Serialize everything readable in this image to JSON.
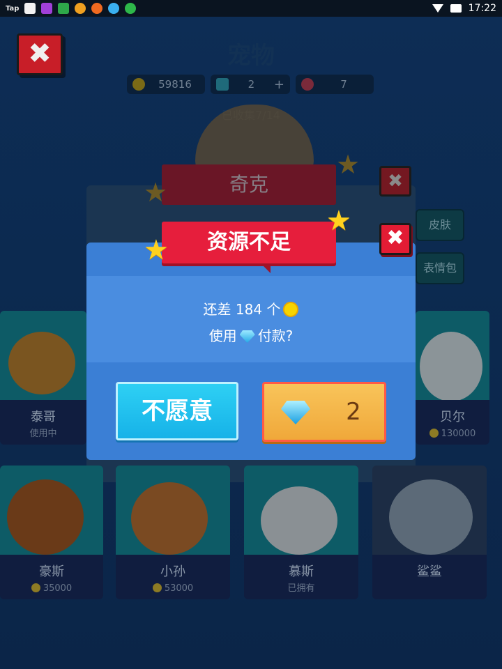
{
  "status_bar": {
    "app_label": "Tap",
    "time": "17:22",
    "notification_icons": [
      "app-1-icon",
      "app-2-icon",
      "gear-icon",
      "android-icon",
      "u-icon",
      "alert-icon",
      "chat-icon",
      "download-icon"
    ]
  },
  "header": {
    "title": "宠物",
    "coins": "59816",
    "gems": "2",
    "add_symbol": "+",
    "tickets": "7",
    "collected": "已收集7/14"
  },
  "pet_panel": {
    "pet_name": "奇克",
    "side_buttons": [
      "皮肤",
      "表情包"
    ]
  },
  "pets": [
    {
      "name": "泰哥",
      "status": "使用中"
    },
    {
      "name": "贝尔",
      "price": "130000"
    },
    {
      "name": "豪斯",
      "price": "35000"
    },
    {
      "name": "小孙",
      "price": "53000"
    },
    {
      "name": "慕斯",
      "status": "已拥有"
    },
    {
      "name": "鲨鲨",
      "status": ""
    }
  ],
  "dialog": {
    "title": "资源不足",
    "line1": "还差 184 个",
    "line2_prefix": "使用",
    "line2_suffix": "付款?",
    "refuse_label": "不愿意",
    "pay_amount": "2",
    "close_symbol": "✖"
  },
  "colors": {
    "ribbon": "#e61e3c",
    "dialog_bg": "#3b7fd5",
    "refuse_button": "#16b2e8",
    "pay_button": "#f0a83a"
  }
}
